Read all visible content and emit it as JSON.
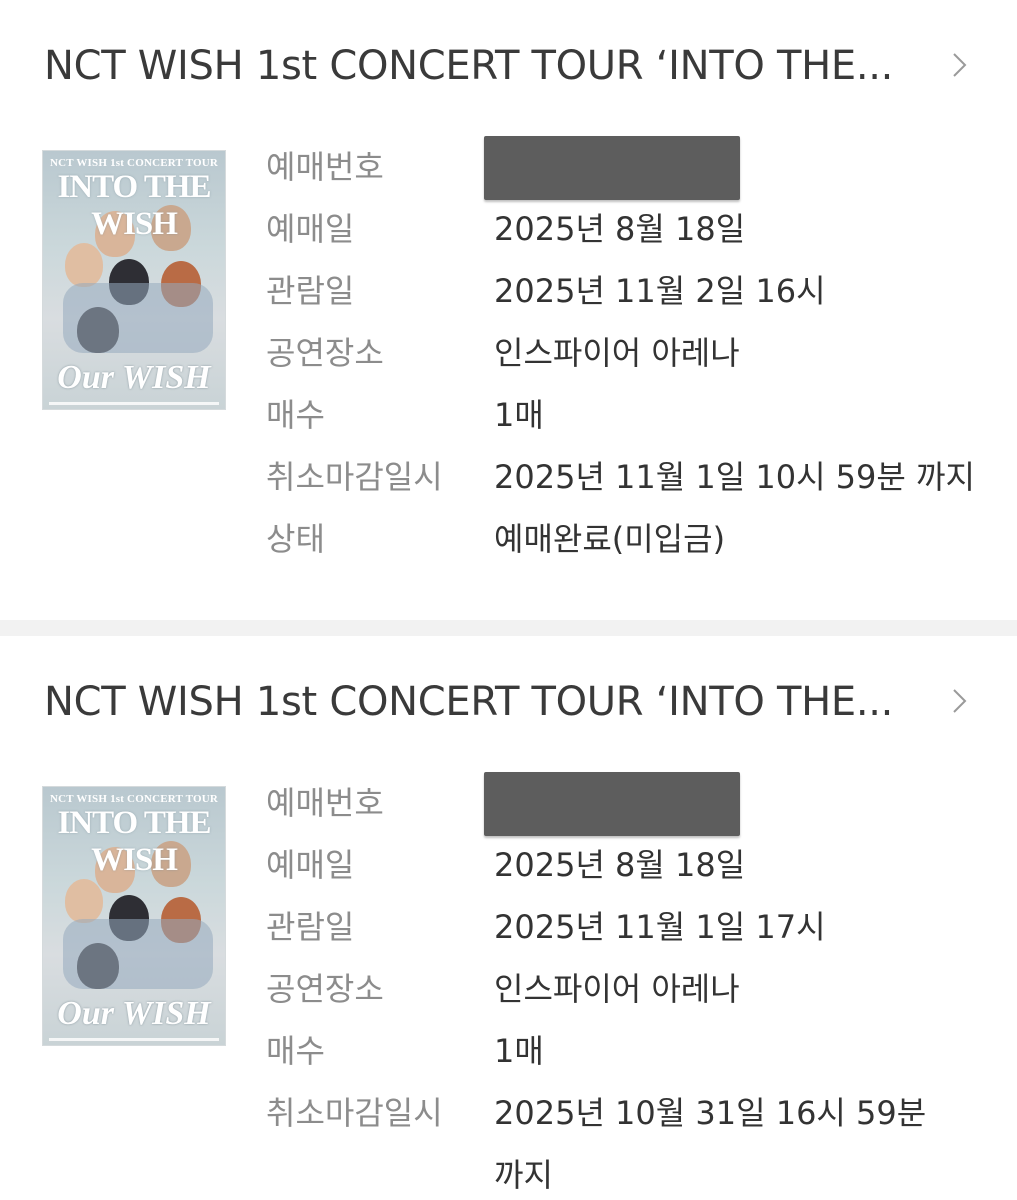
{
  "bookings": [
    {
      "title": "NCT WISH 1st CONCERT TOUR ‘INTO THE...",
      "poster": {
        "top_text": "NCT WISH 1st CONCERT TOUR",
        "main_text": "INTO THE WISH",
        "bottom_text": "Our WISH"
      },
      "fields": [
        {
          "label": "예매번호",
          "value": ""
        },
        {
          "label": "예매일",
          "value": "2025년 8월 18일"
        },
        {
          "label": "관람일",
          "value": "2025년 11월 2일 16시"
        },
        {
          "label": "공연장소",
          "value": "인스파이어 아레나"
        },
        {
          "label": "매수",
          "value": "1매"
        },
        {
          "label": "취소마감일시",
          "value": "2025년 11월 1일 10시 59분 까지"
        },
        {
          "label": "상태",
          "value": "예매완료(미입금)"
        }
      ]
    },
    {
      "title": "NCT WISH 1st CONCERT TOUR ‘INTO THE...",
      "poster": {
        "top_text": "NCT WISH 1st CONCERT TOUR",
        "main_text": "INTO THE WISH",
        "bottom_text": "Our WISH"
      },
      "fields": [
        {
          "label": "예매번호",
          "value": ""
        },
        {
          "label": "예매일",
          "value": "2025년 8월 18일"
        },
        {
          "label": "관람일",
          "value": "2025년 11월 1일 17시"
        },
        {
          "label": "공연장소",
          "value": "인스파이어 아레나"
        },
        {
          "label": "매수",
          "value": "1매"
        },
        {
          "label": "취소마감일시",
          "value": "2025년 10월 31일 16시 59분 까지"
        }
      ]
    }
  ],
  "icons": {
    "chevron": "chevron-right-icon",
    "redaction": "redaction-bar"
  },
  "colors": {
    "label": "#8c8c8c",
    "value": "#333333",
    "title": "#3a3a3a",
    "divider": "#f2f2f2",
    "redaction": "#5d5d5d"
  }
}
